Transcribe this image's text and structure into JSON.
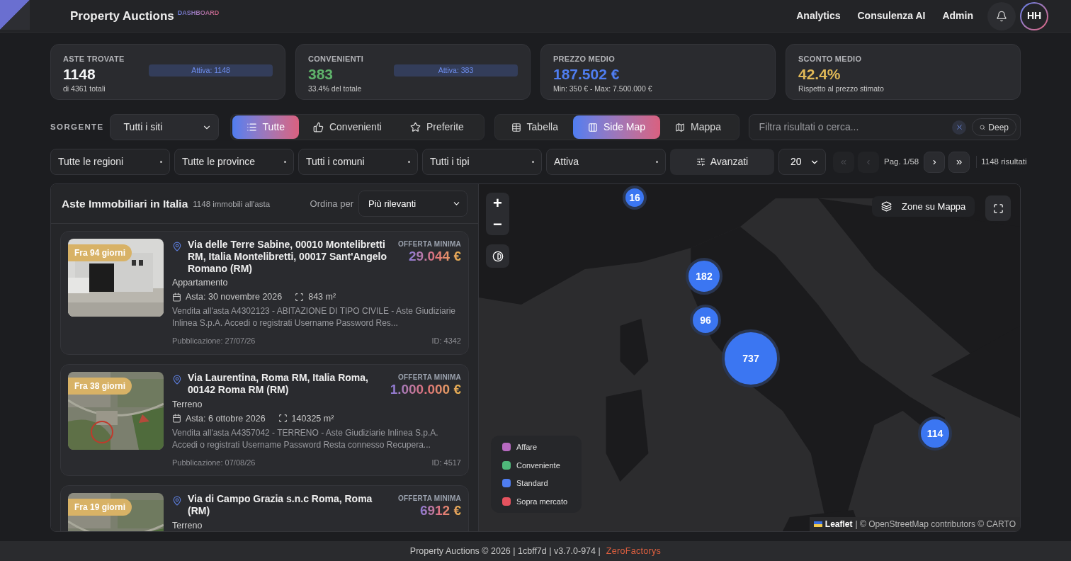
{
  "header": {
    "title": "Property Auctions",
    "subtitle": "DASHBOARD",
    "nav": [
      "Analytics",
      "Consulenza AI",
      "Admin"
    ],
    "avatar": "HH"
  },
  "stats": [
    {
      "label": "ASTE TROVATE",
      "value": "1148",
      "note": "di 4361 totali",
      "badge": "Attiva: 1148",
      "color": "#f3f4f6"
    },
    {
      "label": "CONVENIENTI",
      "value": "383",
      "note": "33.4% del totale",
      "badge": "Attiva: 383",
      "color": "#5fb36b"
    },
    {
      "label": "PREZZO MEDIO",
      "value": "187.502 €",
      "note": "Min: 350 € - Max: 7.500.000 €",
      "color": "#4f7df0"
    },
    {
      "label": "SCONTO MEDIO",
      "value": "42.4%",
      "note": "Rispetto al prezzo stimato",
      "color": "#e0b857"
    }
  ],
  "source": {
    "label": "SORGENTE",
    "value": "Tutti i siti"
  },
  "filter_tabs": [
    {
      "label": "Tutte",
      "kind": "list",
      "selected": true
    },
    {
      "label": "Convenienti",
      "kind": "thumb",
      "selected": false
    },
    {
      "label": "Preferite",
      "kind": "star",
      "selected": false
    }
  ],
  "view_tabs": [
    {
      "label": "Tabella",
      "kind": "table",
      "selected": false
    },
    {
      "label": "Side Map",
      "kind": "columns",
      "selected": true
    },
    {
      "label": "Mappa",
      "kind": "map",
      "selected": false
    }
  ],
  "search": {
    "placeholder": "Filtra risultati o cerca...",
    "deep": "Deep"
  },
  "filters": [
    "Tutte le regioni",
    "Tutte le province",
    "Tutti i comuni",
    "Tutti i tipi",
    "Attiva"
  ],
  "advanced": "Avanzati",
  "page_size": "20",
  "pagination": {
    "first": {
      "label": "«",
      "disabled": true
    },
    "prev": {
      "label": "‹",
      "disabled": true
    },
    "page": "Pag. 1/58",
    "next": {
      "label": "›",
      "disabled": false
    },
    "last": {
      "label": "»",
      "disabled": false
    },
    "results": "1148 risultati"
  },
  "list": {
    "title": "Aste Immobiliari in Italia",
    "count": "1148 immobili all'asta",
    "sort_label": "Ordina per",
    "sort_value": "Più rilevanti"
  },
  "listings": [
    {
      "badge": "Fra 94 giorni",
      "address": "Via delle Terre Sabine, 00010 Montelibretti RM, Italia Montelibretti, 00017 Sant'Angelo Romano (RM)",
      "price_label": "OFFERTA MINIMA",
      "price": "29.044 €",
      "type": "Appartamento",
      "date": "Asta: 30 novembre 2026",
      "area": "843 m²",
      "description": "Vendita all'asta A4302123 - ABITAZIONE DI TIPO CIVILE - Aste Giudiziarie Inlinea S.p.A. Accedi o registrati Username Password Res...",
      "published": "Pubblicazione: 27/07/26",
      "id": "ID: 4342",
      "kind": "building"
    },
    {
      "badge": "Fra 38 giorni",
      "address": "Via Laurentina, Roma RM, Italia Roma, 00142 Roma RM (RM)",
      "price_label": "OFFERTA MINIMA",
      "price": "1.000.000 €",
      "type": "Terreno",
      "date": "Asta: 6 ottobre 2026",
      "area": "140325 m²",
      "description": "Vendita all'asta A4357042 - TERRENO - Aste Giudiziarie Inlinea S.p.A. Accedi o registrati Username Password Resta connesso Recupera...",
      "published": "Pubblicazione: 07/08/26",
      "id": "ID: 4517",
      "kind": "aerial"
    },
    {
      "badge": "Fra 19 giorni",
      "address": "Via di Campo Grazia s.n.c Roma, Roma (RM)",
      "price_label": "OFFERTA MINIMA",
      "price": "6912 €",
      "type": "Terreno",
      "kind": "aerial"
    }
  ],
  "map": {
    "clusters": [
      "16",
      "182",
      "96",
      "737",
      "114"
    ],
    "zones": "Zone su Mappa",
    "zoom_in": "+",
    "zoom_out": "−",
    "legend": [
      {
        "label": "Affare",
        "color": "#b76ac0"
      },
      {
        "label": "Conveniente",
        "color": "#4fb87a"
      },
      {
        "label": "Standard",
        "color": "#4f7df0"
      },
      {
        "label": "Sopra mercato",
        "color": "#e5535f"
      }
    ],
    "attribution_link": "Leaflet",
    "attribution": "| © OpenStreetMap contributors © CARTO"
  },
  "footer": {
    "text": "Property Auctions © 2026 | 1cbff7d | v3.7.0-974 |",
    "brand": "ZeroFactorys"
  }
}
